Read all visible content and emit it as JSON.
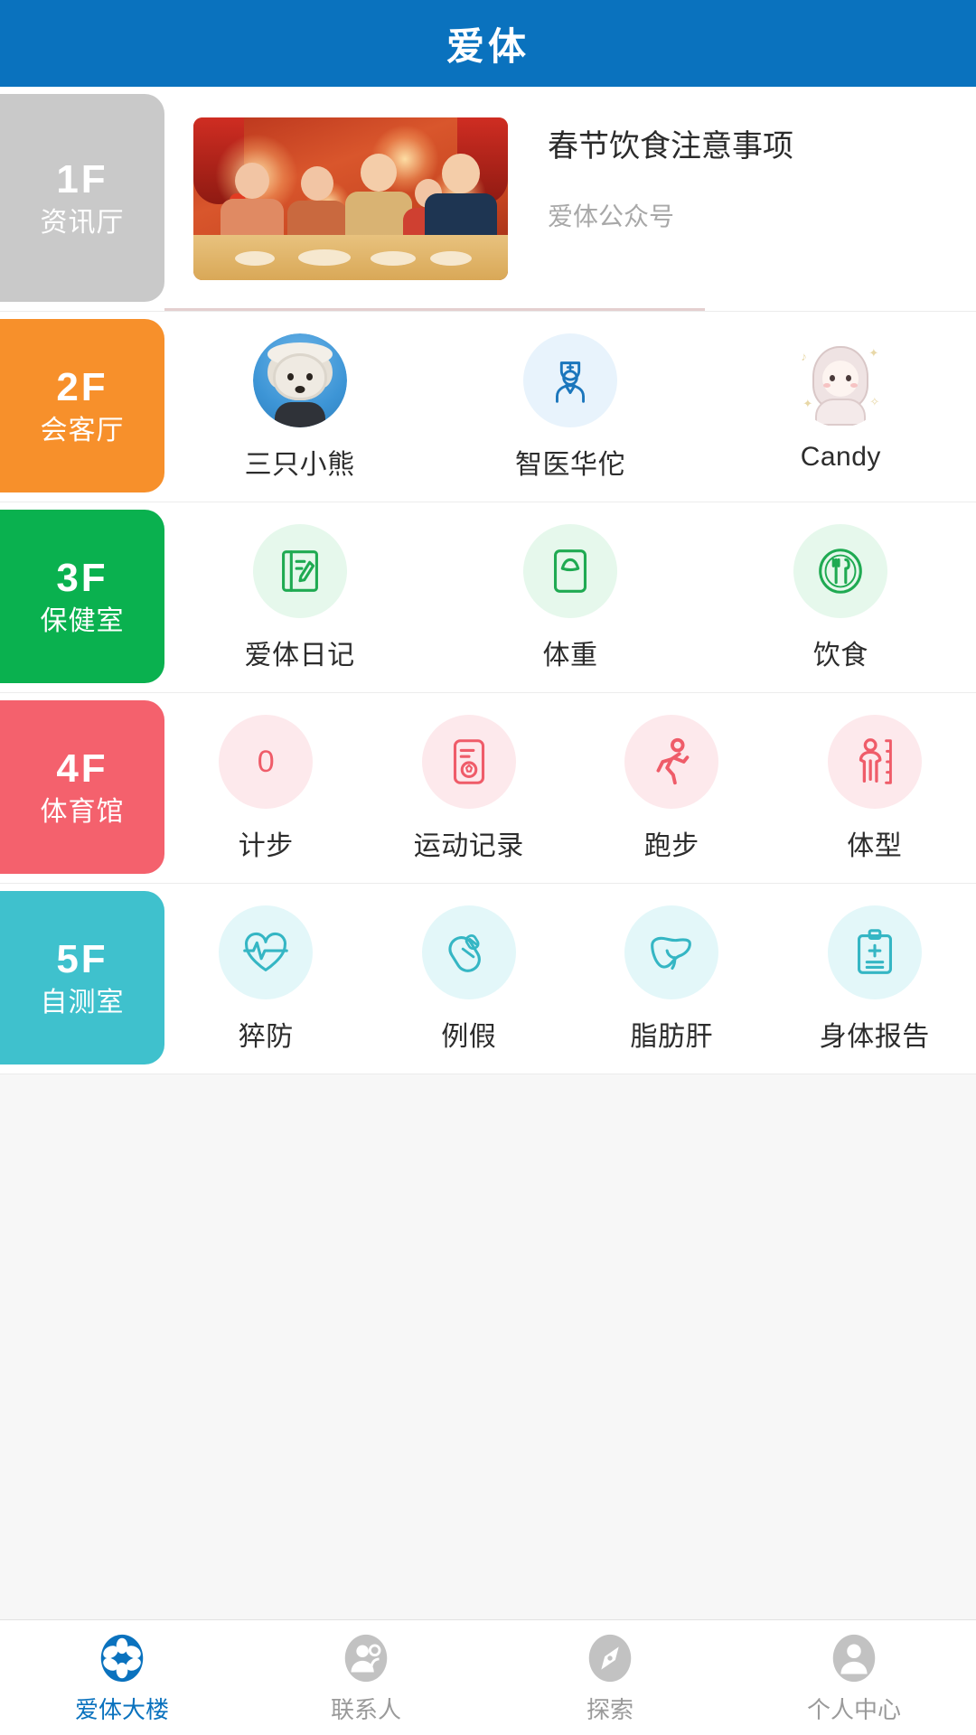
{
  "header": {
    "title": "爱体",
    "bg_color": "#0a72be",
    "text_color": "#ffffff"
  },
  "news": {
    "title": "春节饮食注意事项",
    "source": "爱体公众号",
    "thumb_alt": "春节家庭聚餐插画"
  },
  "floors": [
    {
      "num": "1F",
      "name": "资讯厅",
      "color": "#c9c9c9",
      "type": "news",
      "items": []
    },
    {
      "num": "2F",
      "name": "会客厅",
      "color": "#f7902b",
      "type": "contacts",
      "items": [
        {
          "label": "三只小熊",
          "icon": "dog-photo-avatar",
          "icon_color": "#3d95d6",
          "bg": "#e3f1fb"
        },
        {
          "label": "智医华佗",
          "icon": "doctor-icon",
          "icon_color": "#1b76bc",
          "bg": "#e8f3fc"
        },
        {
          "label": "Candy",
          "icon": "anime-girl-avatar",
          "icon_color": "#d9c7c7",
          "bg": "#ffffff"
        }
      ]
    },
    {
      "num": "3F",
      "name": "保健室",
      "color": "#0aa council",
      "items": []
    },
    {
      "num": "4F",
      "name": "体育馆",
      "color": "#f4616d",
      "items": []
    },
    {
      "num": "5F",
      "name": "自测室",
      "color": "#3fc1cd",
      "items": []
    }
  ],
  "floor1": {
    "num": "1F",
    "name": "资讯厅",
    "color": "#c9c9c9"
  },
  "floor2": {
    "num": "2F",
    "name": "会客厅",
    "color": "#f7902b",
    "items": [
      {
        "label": "三只小熊",
        "icon": "dog-photo-avatar"
      },
      {
        "label": "智医华佗",
        "icon": "doctor-icon"
      },
      {
        "label": "Candy",
        "icon": "anime-girl-avatar"
      }
    ]
  },
  "floor3": {
    "num": "3F",
    "name": "保健室",
    "color": "#0ab14f",
    "icon_color": "#1faa52",
    "icon_bg": "#e6f8ec",
    "items": [
      {
        "label": "爱体日记",
        "icon": "diary-icon"
      },
      {
        "label": "体重",
        "icon": "weight-scale-icon"
      },
      {
        "label": "饮食",
        "icon": "plate-cutlery-icon"
      }
    ]
  },
  "floor4": {
    "num": "4F",
    "name": "体育馆",
    "color": "#f4616d",
    "icon_color": "#ef5c69",
    "icon_bg": "#fde9ec",
    "items": [
      {
        "label": "计步",
        "icon": "step-count-icon",
        "value": "0"
      },
      {
        "label": "运动记录",
        "icon": "exercise-record-icon"
      },
      {
        "label": "跑步",
        "icon": "running-icon"
      },
      {
        "label": "体型",
        "icon": "body-shape-icon"
      }
    ]
  },
  "floor5": {
    "num": "5F",
    "name": "自测室",
    "color": "#3fc1cd",
    "icon_color": "#35b6c4",
    "icon_bg": "#e3f7f9",
    "items": [
      {
        "label": "猝防",
        "icon": "heart-pulse-icon"
      },
      {
        "label": "例假",
        "icon": "sanitary-pad-icon"
      },
      {
        "label": "脂肪肝",
        "icon": "liver-icon"
      },
      {
        "label": "身体报告",
        "icon": "clipboard-report-icon"
      }
    ]
  },
  "tabbar": {
    "active_color": "#0a72be",
    "inactive_color": "#c2c2c2",
    "items": [
      {
        "label": "爱体大楼",
        "icon": "flower-building-icon",
        "active": true
      },
      {
        "label": "联系人",
        "icon": "contacts-icon",
        "active": false
      },
      {
        "label": "探索",
        "icon": "compass-icon",
        "active": false
      },
      {
        "label": "个人中心",
        "icon": "profile-icon",
        "active": false
      }
    ]
  }
}
